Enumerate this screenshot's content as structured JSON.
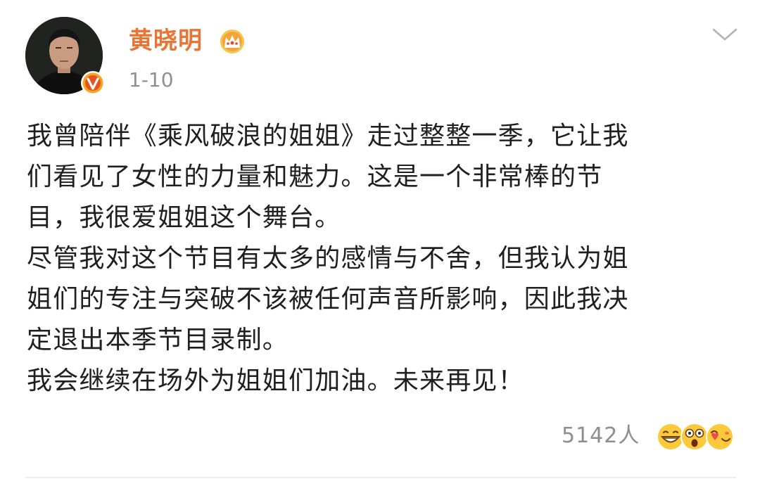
{
  "post": {
    "author": {
      "name": "黄晓明",
      "badge_icon": "crown-icon",
      "verified_icon": "verified-v-icon",
      "name_color": "#eb7333"
    },
    "time": "1-10",
    "menu_icon": "chevron-down-icon",
    "lines": [
      "我曾陪伴《乘风破浪的姐姐》走过整整一季，它让我",
      "们看见了女性的力量和魅力。这是一个非常棒的节",
      "目，我很爱姐姐这个舞台。",
      "尽管我对这个节目有太多的感情与不舍，但我认为姐",
      "姐们的专注与突破不该被任何声音所影响，因此我决",
      "定退出本季节目录制。",
      "我会继续在场外为姐姐们加油。未来再见！"
    ],
    "footer": {
      "like_count": "5142人",
      "reaction_icons": [
        "grinning-emoji-icon",
        "astonished-emoji-icon",
        "heart-face-emoji-icon"
      ]
    }
  }
}
